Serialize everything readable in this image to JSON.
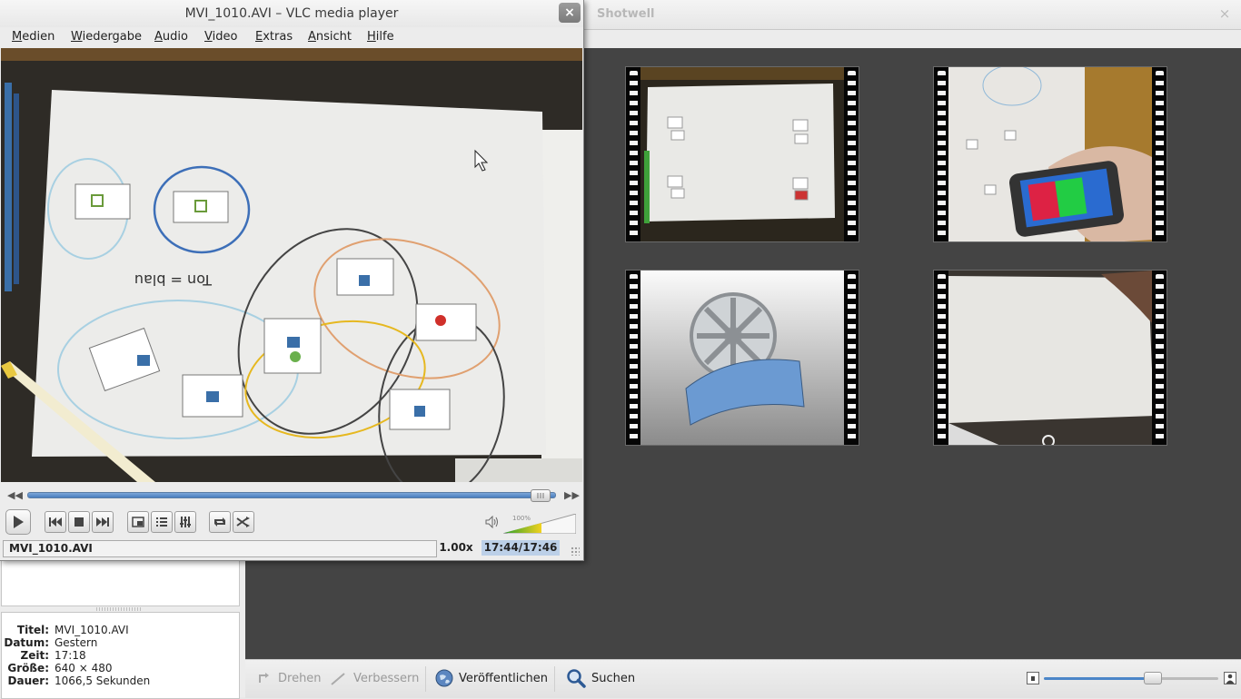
{
  "shotwell": {
    "title": "Shotwell",
    "close_glyph": "×",
    "properties": [
      {
        "key": "Titel:",
        "value": "MVI_1010.AVI"
      },
      {
        "key": "Datum:",
        "value": "Gestern"
      },
      {
        "key": "Zeit:",
        "value": "17:18"
      },
      {
        "key": "Größe:",
        "value": "640 × 480"
      },
      {
        "key": "Dauer:",
        "value": "1066,5 Sekunden"
      }
    ],
    "toolbar": {
      "rotate_label": "Drehen",
      "enhance_label": "Verbessern",
      "publish_label": "Veröffentlichen",
      "search_label": "Suchen"
    },
    "zoom_level": 0.62,
    "thumbnails": [
      "paper-cards-video",
      "phone-on-paper-video",
      "generic-video-reel",
      "blank-paper-video"
    ]
  },
  "vlc": {
    "title": "MVI_1010.AVI – VLC media player",
    "close_glyph": "×",
    "menu": [
      "Medien",
      "Wiedergabe",
      "Audio",
      "Video",
      "Extras",
      "Ansicht",
      "Hilfe"
    ],
    "video_handwriting": "Ton = blau",
    "status": {
      "file": "MVI_1010.AVI",
      "speed": "1.00x",
      "time": "17:44/17:46"
    },
    "volume_percent": "100%",
    "seek_fraction": 0.99,
    "icons": {
      "play": "play-icon",
      "prev": "previous-icon",
      "stop": "stop-icon",
      "next": "next-icon",
      "fullscreen": "fullscreen-icon",
      "playlist": "playlist-icon",
      "extended": "extended-settings-icon",
      "loop": "loop-icon",
      "random": "shuffle-icon",
      "volume": "speaker-icon"
    },
    "colors": {
      "seek_fill": "#4a7fc0",
      "time_bg": "#bcd0e8",
      "volume_gradient_start": "#2ea02e",
      "volume_gradient_end": "#f2d21e"
    }
  }
}
